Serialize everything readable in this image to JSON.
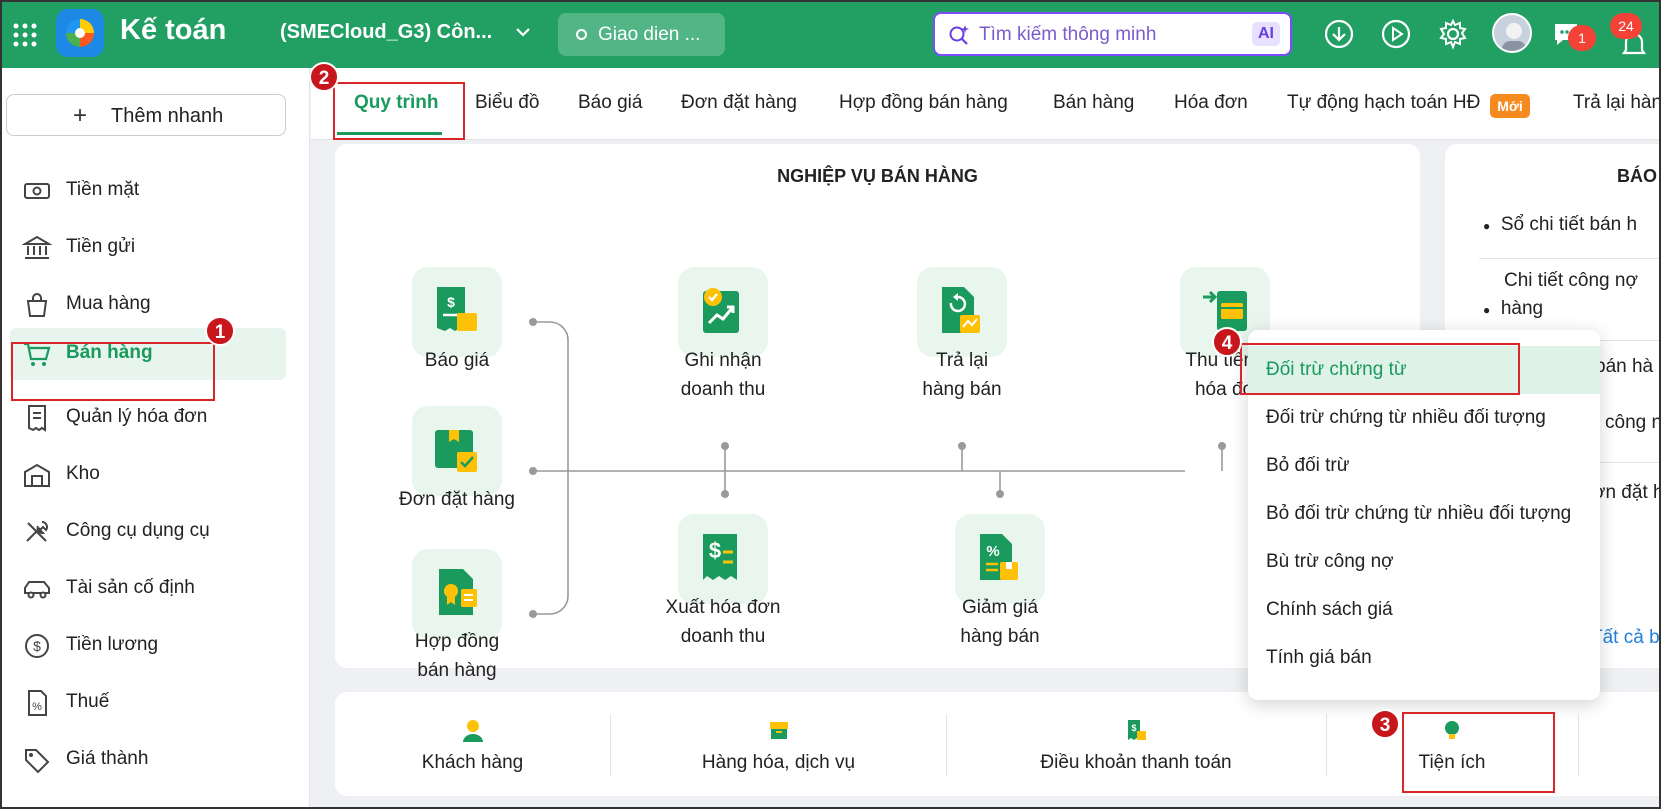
{
  "header": {
    "app_title": "Kế toán",
    "company": "(SMECloud_G3) Côn...",
    "ui_toggle": "Giao dien ...",
    "search_placeholder": "Tìm kiếm thông minh",
    "search_ai": "AI",
    "chat_badge": "1",
    "notif_badge": "24"
  },
  "sidebar": {
    "quick_add": "Thêm nhanh",
    "items": [
      {
        "label": "Tiền mặt",
        "icon": "cash-icon"
      },
      {
        "label": "Tiền gửi",
        "icon": "bank-icon"
      },
      {
        "label": "Mua hàng",
        "icon": "shopping-bag-icon"
      },
      {
        "label": "Bán hàng",
        "icon": "cart-icon"
      },
      {
        "label": "Quản lý hóa đơn",
        "icon": "invoice-icon"
      },
      {
        "label": "Kho",
        "icon": "warehouse-icon"
      },
      {
        "label": "Công cụ dụng cụ",
        "icon": "tools-icon"
      },
      {
        "label": "Tài sản cố định",
        "icon": "car-icon"
      },
      {
        "label": "Tiền lương",
        "icon": "dollar-circle-icon"
      },
      {
        "label": "Thuế",
        "icon": "tax-icon"
      },
      {
        "label": "Giá thành",
        "icon": "price-tag-icon"
      }
    ]
  },
  "tabs": [
    "Quy trình",
    "Biểu đồ",
    "Báo giá",
    "Đơn đặt hàng",
    "Hợp đồng bán hàng",
    "Bán hàng",
    "Hóa đơn",
    "Tự động hạch toán HĐ",
    "Trả lại hàn"
  ],
  "new_badge": "Mới",
  "workflow": {
    "title": "NGHIỆP VỤ BÁN HÀNG",
    "nodes": {
      "bao_gia": "Báo giá",
      "don_dat_hang": "Đơn đặt hàng",
      "hop_dong_1": "Hợp đồng",
      "hop_dong_2": "bán hàng",
      "ghi_nhan_1": "Ghi nhận",
      "ghi_nhan_2": "doanh thu",
      "tra_lai_1": "Trả lại",
      "tra_lai_2": "hàng bán",
      "thu_tien_1": "Thu tiền t",
      "thu_tien_2": "hóa đơ",
      "xuat_hd_1": "Xuất hóa đơn",
      "xuat_hd_2": "doanh thu",
      "giam_gia_1": "Giảm giá",
      "giam_gia_2": "hàng bán"
    }
  },
  "reports": {
    "title": "BÁO",
    "items": [
      "Sổ chi tiết bán h",
      "Chi tiết công nợ",
      "hàng",
      "bán hà",
      "công n",
      "ơn đặt h"
    ],
    "all_link": "Tất cả b"
  },
  "bottom": {
    "items": [
      "Khách hàng",
      "Hàng hóa, dịch vụ",
      "Điều khoản thanh toán",
      "Tiện ích"
    ]
  },
  "menu": {
    "items": [
      "Đối trừ chứng từ",
      "Đối trừ chứng từ nhiều đối tượng",
      "Bỏ đối trừ",
      "Bỏ đối trừ chứng từ nhiều đối tượng",
      "Bù trừ công nợ",
      "Chính sách giá",
      "Tính giá bán"
    ]
  },
  "annotations": [
    "1",
    "2",
    "3",
    "4"
  ],
  "colors": {
    "brand": "#22a064",
    "accent": "#1a9a5c",
    "annotation": "#d9262b",
    "new_badge": "#f58a1f"
  }
}
